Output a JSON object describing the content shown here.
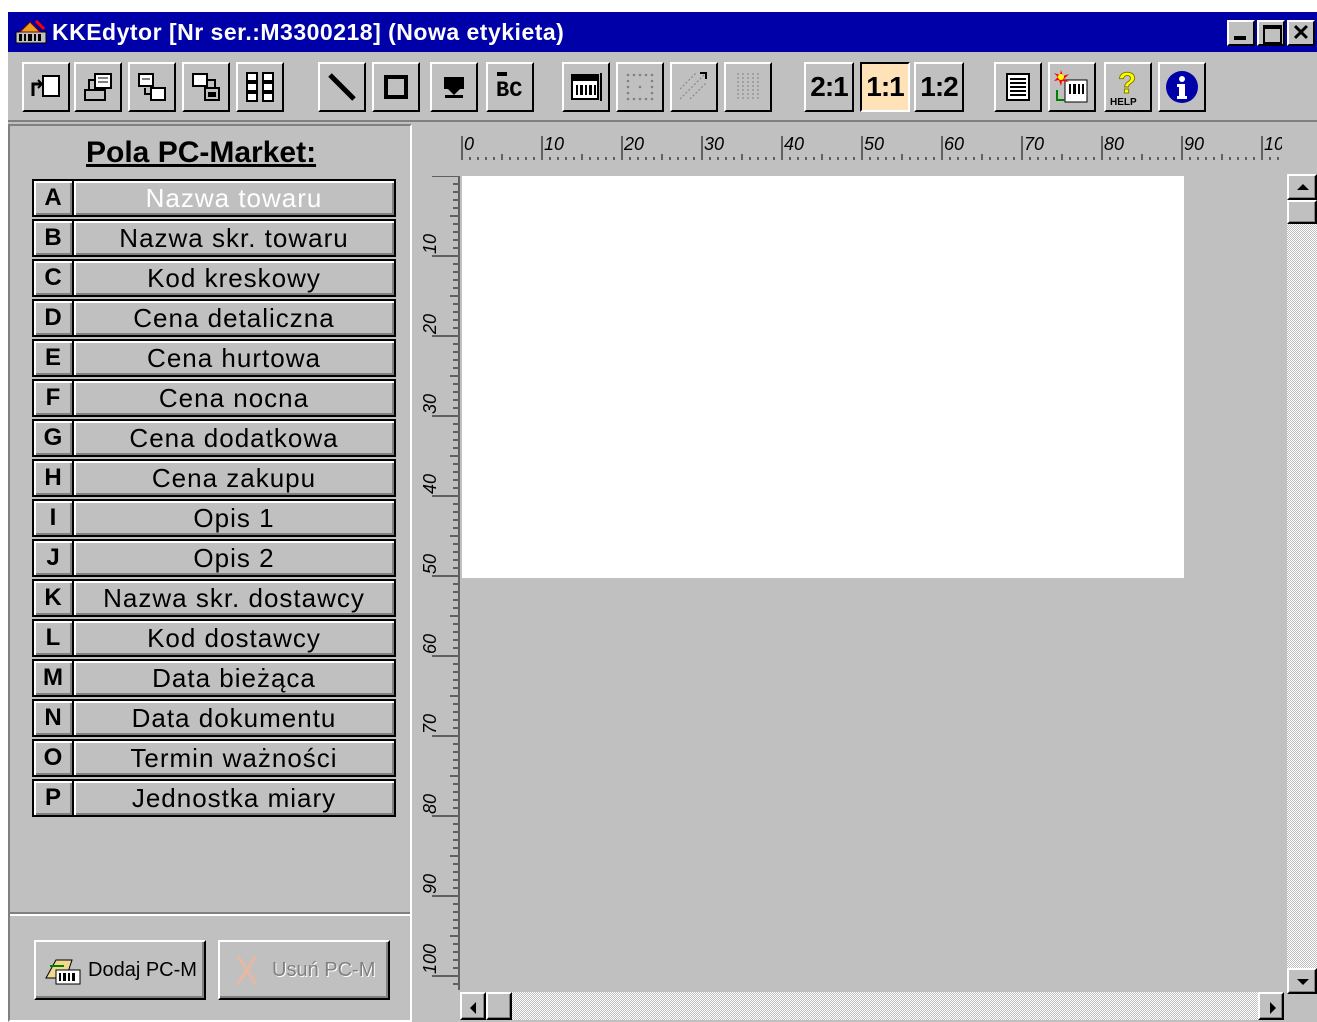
{
  "window": {
    "title": "KKEdytor [Nr ser.:M3300218] (Nowa etykieta)"
  },
  "toolbar": {
    "tools": [
      {
        "name": "new-label-icon"
      },
      {
        "name": "open-label-icon"
      },
      {
        "name": "save-label-icon"
      },
      {
        "name": "save-as-icon"
      },
      {
        "name": "grid-layout-icon"
      },
      {
        "name": "draw-line-icon"
      },
      {
        "name": "draw-rectangle-icon"
      },
      {
        "name": "insert-image-icon"
      },
      {
        "name": "insert-text-icon"
      },
      {
        "name": "insert-barcode-icon"
      },
      {
        "name": "dotted-grid-icon"
      },
      {
        "name": "diagonal-grid-icon"
      },
      {
        "name": "vertical-grid-icon"
      },
      {
        "name": "print-preview-icon"
      },
      {
        "name": "barcode-settings-icon"
      },
      {
        "name": "help-icon"
      },
      {
        "name": "info-icon"
      }
    ],
    "zoom": [
      "2:1",
      "1:1",
      "1:2"
    ],
    "zoom_selected": "1:1",
    "help_label": "HELP"
  },
  "panel": {
    "title": "Pola PC-Market:",
    "fields": [
      {
        "letter": "A",
        "name": "Nazwa towaru"
      },
      {
        "letter": "B",
        "name": "Nazwa skr. towaru"
      },
      {
        "letter": "C",
        "name": "Kod kreskowy"
      },
      {
        "letter": "D",
        "name": "Cena detaliczna"
      },
      {
        "letter": "E",
        "name": "Cena hurtowa"
      },
      {
        "letter": "F",
        "name": "Cena nocna"
      },
      {
        "letter": "G",
        "name": "Cena dodatkowa"
      },
      {
        "letter": "H",
        "name": "Cena zakupu"
      },
      {
        "letter": "I",
        "name": "Opis 1"
      },
      {
        "letter": "J",
        "name": "Opis 2"
      },
      {
        "letter": "K",
        "name": "Nazwa skr. dostawcy"
      },
      {
        "letter": "L",
        "name": "Kod dostawcy"
      },
      {
        "letter": "M",
        "name": "Data bieżąca"
      },
      {
        "letter": "N",
        "name": "Data dokumentu"
      },
      {
        "letter": "O",
        "name": "Termin ważności"
      },
      {
        "letter": "P",
        "name": "Jednostka miary"
      }
    ],
    "add_button": "Dodaj PC-M",
    "remove_button": "Usuń PC-M"
  },
  "rulers": {
    "top_labels": [
      "0",
      "10",
      "20",
      "30",
      "40",
      "50",
      "60",
      "70",
      "80",
      "90",
      "10"
    ],
    "left_labels": [
      "10",
      "20",
      "30",
      "40",
      "50",
      "60",
      "70",
      "80",
      "90",
      "100"
    ]
  },
  "colors": {
    "titlebar": "#0000a8",
    "face": "#c0c0c0",
    "pressed": "#ffe2b8",
    "selected_text": "#ffffff"
  }
}
